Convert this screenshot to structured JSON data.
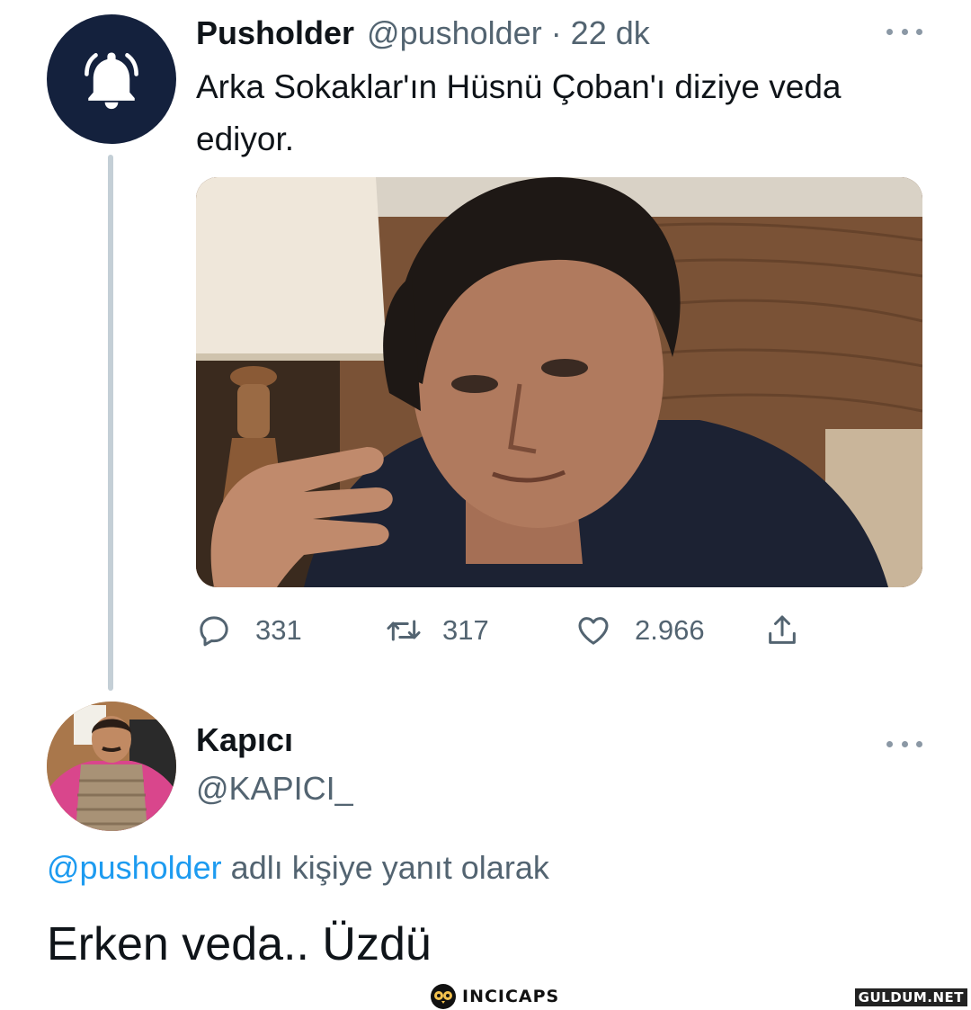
{
  "tweet1": {
    "display_name": "Pusholder",
    "handle_time": "@pusholder · 22 dk",
    "text": "Arka Sokaklar'ın Hüsnü Çoban'ı diziye veda ediyor.",
    "avatar_icon": "bell-icon",
    "media_image": "photo of a man in a dark suit against a wooden wall",
    "actions": {
      "reply_count": "331",
      "retweet_count": "317",
      "like_count": "2.966"
    }
  },
  "tweet2": {
    "display_name": "Kapıcı",
    "handle": "@KAPICI_",
    "reply_mention": "@pusholder",
    "reply_suffix": " adlı kişiye yanıt olarak",
    "text": "Erken veda.. Üzdü"
  },
  "watermarks": {
    "incicaps": "INCICAPS",
    "guldum": "GULDUM.NET"
  },
  "colors": {
    "link": "#1d9bf0",
    "secondary_text": "#536471",
    "bell_avatar_bg": "#14213d"
  }
}
